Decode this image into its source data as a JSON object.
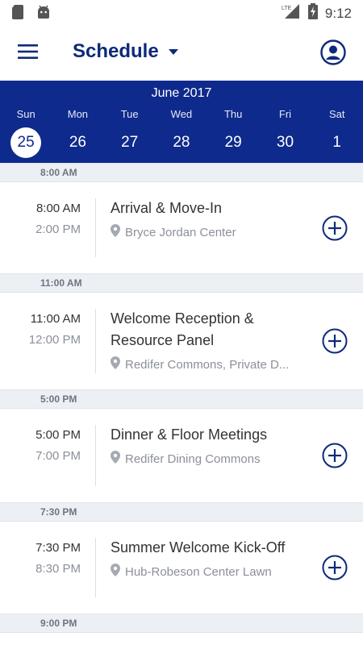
{
  "status_bar": {
    "time": "9:12",
    "network": "LTE",
    "icons": [
      "sd-card-icon",
      "android-icon",
      "signal-icon",
      "battery-charging-icon"
    ]
  },
  "app_bar": {
    "title": "Schedule",
    "menu_icon": "hamburger-menu-icon",
    "profile_icon": "account-circle-icon"
  },
  "calendar": {
    "month": "June 2017",
    "days": [
      {
        "dow": "Sun",
        "num": "25",
        "selected": true
      },
      {
        "dow": "Mon",
        "num": "26"
      },
      {
        "dow": "Tue",
        "num": "27"
      },
      {
        "dow": "Wed",
        "num": "28"
      },
      {
        "dow": "Thu",
        "num": "29"
      },
      {
        "dow": "Fri",
        "num": "30"
      },
      {
        "dow": "Sat",
        "num": "1"
      }
    ]
  },
  "schedule": {
    "groups": [
      {
        "header": "8:00 AM",
        "event": {
          "start": "8:00 AM",
          "end": "2:00 PM",
          "title": "Arrival & Move-In",
          "location": "Bryce Jordan Center"
        }
      },
      {
        "header": "11:00 AM",
        "event": {
          "start": "11:00 AM",
          "end": "12:00 PM",
          "title": "Welcome Reception & Resource Panel",
          "location": "Redifer Commons, Private D..."
        }
      },
      {
        "header": "5:00 PM",
        "event": {
          "start": "5:00 PM",
          "end": "7:00 PM",
          "title": "Dinner & Floor Meetings",
          "location": "Redifer Dining Commons"
        }
      },
      {
        "header": "7:30 PM",
        "event": {
          "start": "7:30 PM",
          "end": "8:30 PM",
          "title": "Summer Welcome Kick-Off",
          "location": "Hub-Robeson Center Lawn"
        }
      },
      {
        "header": "9:00 PM"
      }
    ]
  },
  "colors": {
    "brand_navy": "#0e2a8c",
    "title_navy": "#0d2a7a",
    "header_gray": "#eceff3",
    "muted_text": "#8b9099"
  }
}
